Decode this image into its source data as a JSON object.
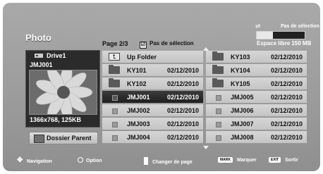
{
  "header": {
    "title": "Photo",
    "page": "Page 2/3",
    "pas_selection": "Pas de sélection",
    "pas_selection_check": "☑",
    "selection_label": "Pas de sélection",
    "storage_fill": 0.34,
    "espace": "Espace libre 150 MB"
  },
  "preview": {
    "drive": "Drive1",
    "filename": "JMJ001",
    "info": "1366x768, 125KB"
  },
  "parent_button": {
    "label": "Dossier Parent"
  },
  "grid": {
    "left": [
      {
        "name": "Up Folder",
        "date": "",
        "type": "up"
      },
      {
        "name": "KY101",
        "date": "02/12/2010",
        "type": "folder"
      },
      {
        "name": "KY102",
        "date": "02/12/2010",
        "type": "folder"
      },
      {
        "name": "JMJ001",
        "date": "02/12/2010",
        "type": "file",
        "selected": true
      },
      {
        "name": "JMJ002",
        "date": "02/12/2010",
        "type": "file"
      },
      {
        "name": "JMJ003",
        "date": "02/12/2010",
        "type": "file"
      },
      {
        "name": "JMJ004",
        "date": "02/12/2010",
        "type": "file"
      }
    ],
    "right": [
      {
        "name": "KY103",
        "date": "02/12/2010",
        "type": "folder"
      },
      {
        "name": "KY104",
        "date": "02/12/2010",
        "type": "folder"
      },
      {
        "name": "KY105",
        "date": "02/12/2010",
        "type": "folder"
      },
      {
        "name": "JMJ005",
        "date": "02/12/2010",
        "type": "file"
      },
      {
        "name": "JMJ006",
        "date": "02/12/2010",
        "type": "file"
      },
      {
        "name": "JMJ007",
        "date": "02/12/2010",
        "type": "file"
      },
      {
        "name": "JMJ008",
        "date": "02/12/2010",
        "type": "file"
      }
    ]
  },
  "footer": {
    "navigation": "Navigation",
    "option": "Option",
    "changer": "Changer de page",
    "mark_key": "MARK",
    "marquer": "Marquer",
    "exit_key": "EXIT",
    "sortir": "Sortir"
  }
}
